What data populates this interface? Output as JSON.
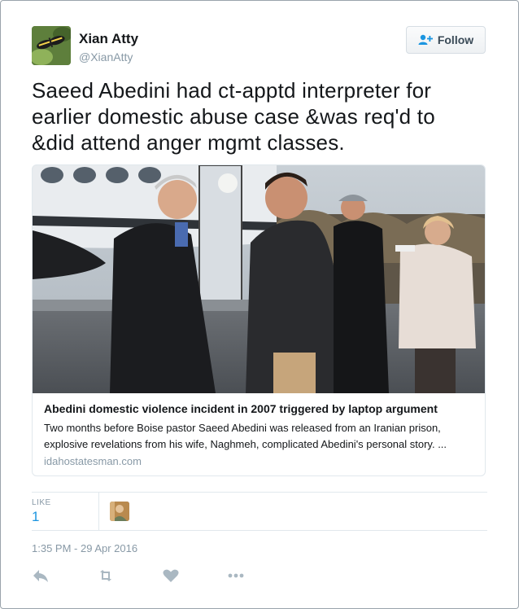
{
  "author": {
    "display_name": "Xian Atty",
    "screen_name": "@XianAtty"
  },
  "follow_button": {
    "label": "Follow"
  },
  "tweet": {
    "text_line1": "Saeed Abedini had ct-apptd interpreter for",
    "text_line2": "earlier domestic abuse case &was req'd to",
    "text_line3": "&did attend anger mgmt classes."
  },
  "card": {
    "title": "Abedini domestic violence incident in 2007 triggered by laptop argument",
    "description_line1": "Two months before Boise pastor Saeed Abedini was released from an Iranian prison,",
    "description_line2": "explosive revelations from his wife, Naghmeh, complicated Abedini's personal story. ...",
    "domain": "idahostatesman.com"
  },
  "stats": {
    "likes_label": "LIKE",
    "likes_count": "1"
  },
  "timestamp": "1:35 PM - 29 Apr 2016",
  "actions": {
    "reply_icon": "reply-icon",
    "retweet_icon": "retweet-icon",
    "like_icon": "heart-icon",
    "more_icon": "more-icon"
  },
  "colors": {
    "link_blue": "#1b95e0",
    "muted_gray": "#8899a6",
    "icon_gray": "#aab8c2"
  }
}
